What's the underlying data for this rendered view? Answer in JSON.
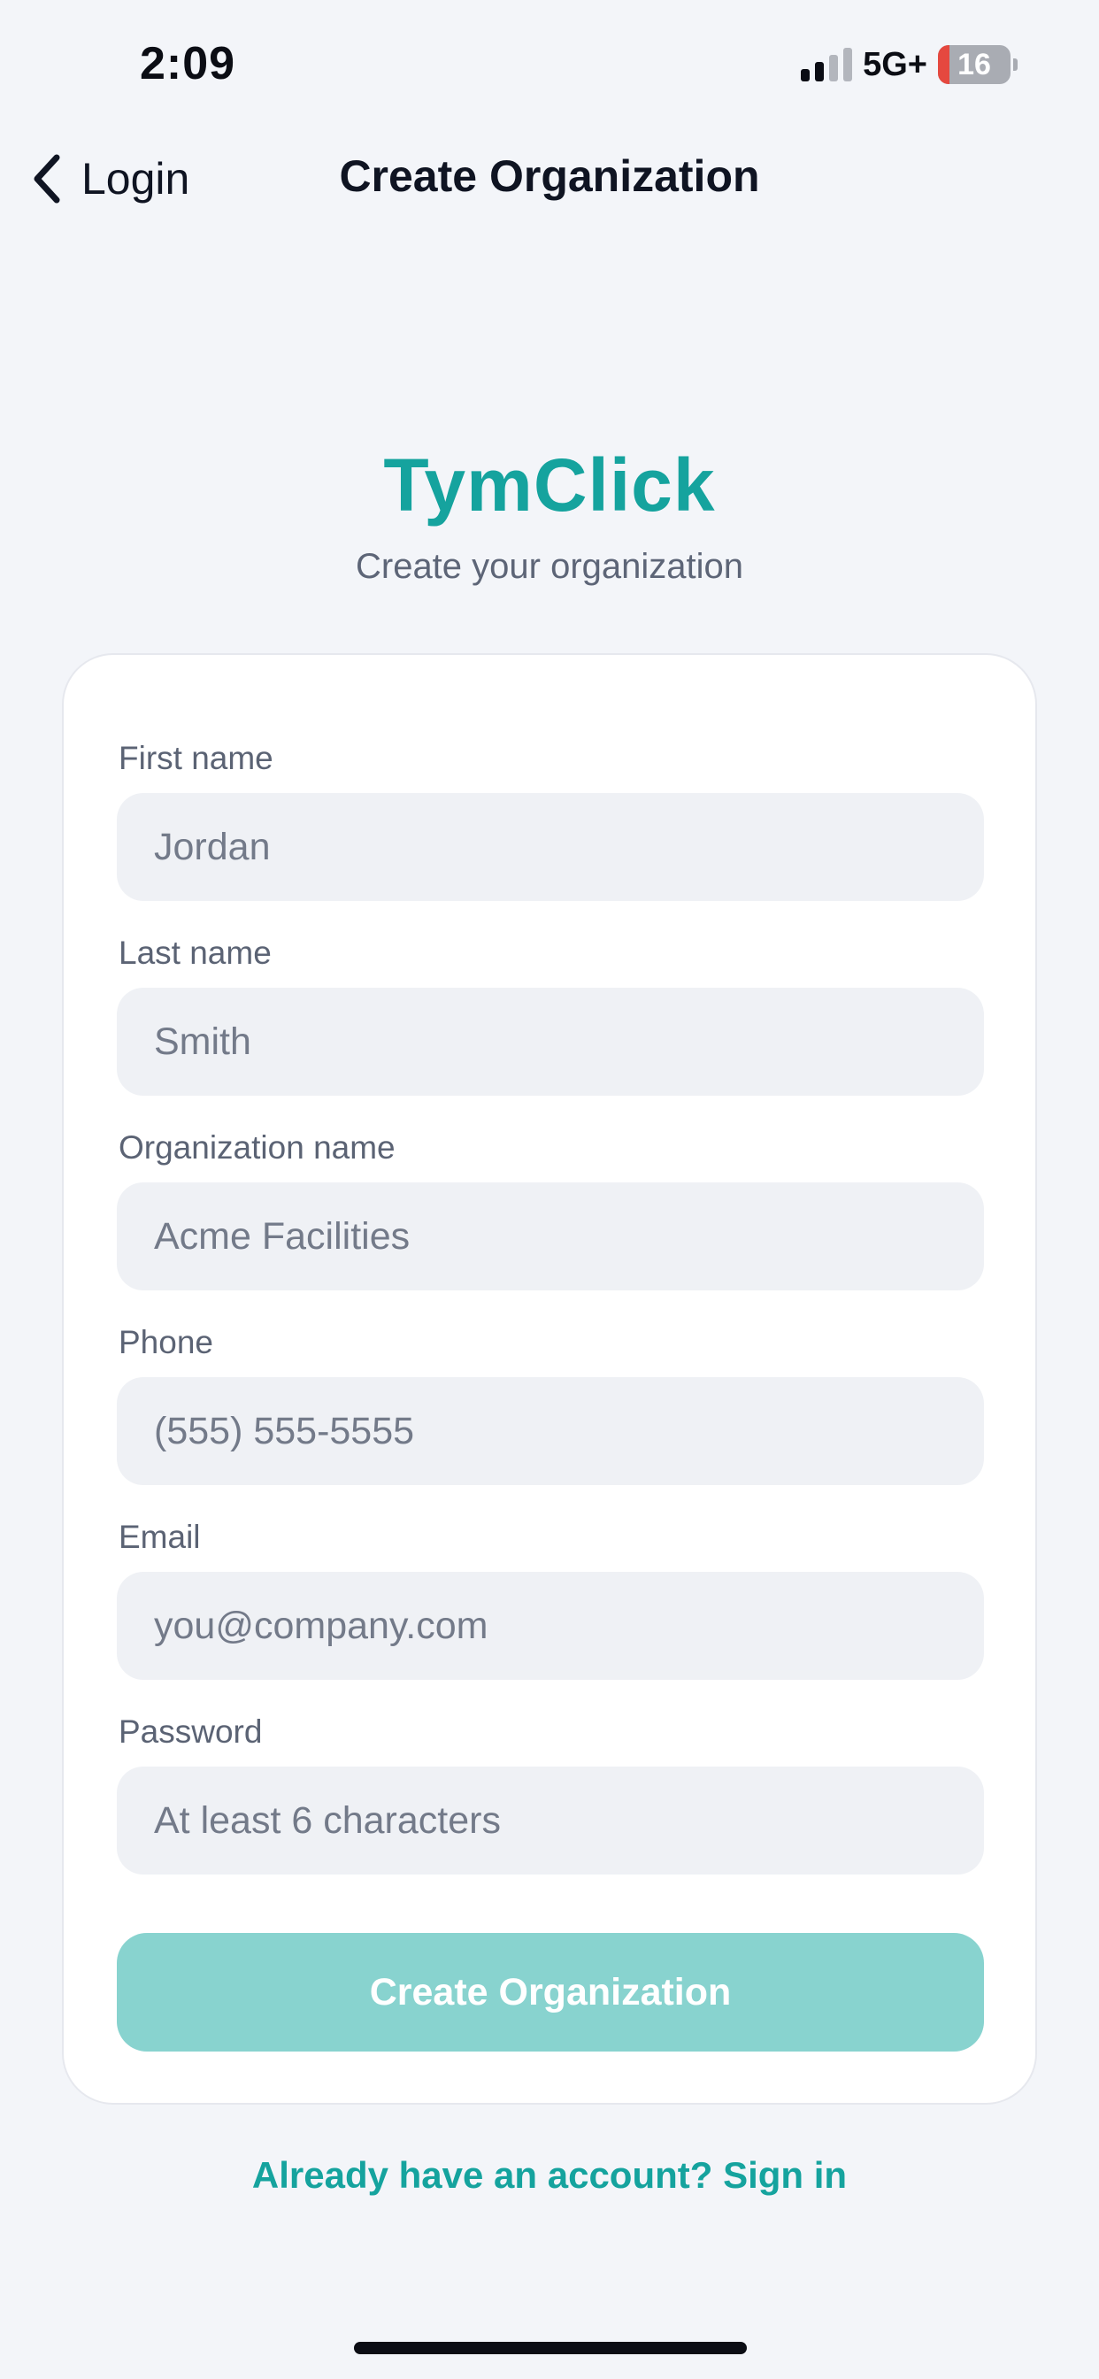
{
  "status_bar": {
    "time": "2:09",
    "network": "5G+",
    "battery_level": "16",
    "battery_fraction": 0.16,
    "signal_bars_active": 2
  },
  "nav": {
    "back_label": "Login",
    "title": "Create Organization"
  },
  "brand": {
    "name": "TymClick",
    "tagline": "Create your organization"
  },
  "form": {
    "fields": [
      {
        "label": "First name",
        "placeholder": "Jordan"
      },
      {
        "label": "Last name",
        "placeholder": "Smith"
      },
      {
        "label": "Organization name",
        "placeholder": "Acme Facilities"
      },
      {
        "label": "Phone",
        "placeholder": "(555) 555-5555"
      },
      {
        "label": "Email",
        "placeholder": "you@company.com"
      },
      {
        "label": "Password",
        "placeholder": "At least 6 characters"
      }
    ],
    "submit_label": "Create Organization"
  },
  "footer": {
    "signin_link": "Already have an account? Sign in"
  },
  "colors": {
    "accent": "#15a39e",
    "button_disabled": "#88d3cf",
    "background": "#f3f5f9",
    "input_background": "#eff1f5",
    "battery_low": "#e5483f"
  },
  "icons": {
    "back": "chevron-left-icon",
    "signal": "cellular-signal-icon",
    "battery": "battery-icon"
  }
}
